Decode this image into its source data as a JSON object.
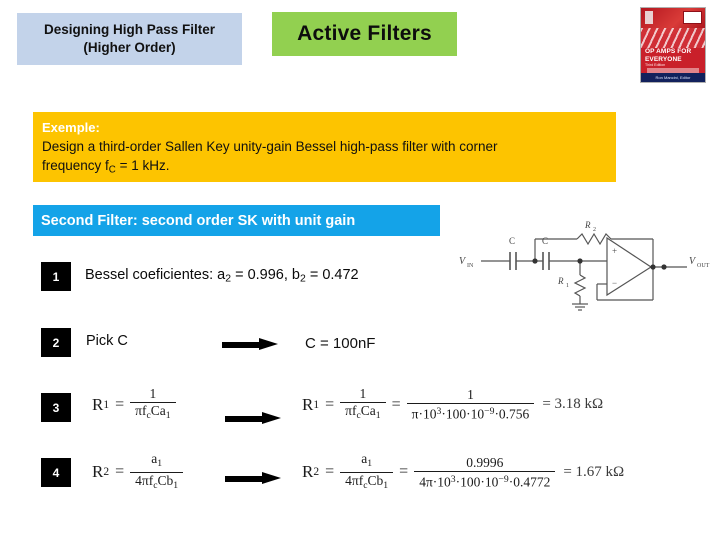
{
  "header": {
    "title_line1": "Designing High Pass Filter",
    "title_line2": "(Higher Order)",
    "topic": "Active Filters",
    "title_bg": "#c3d3ea",
    "topic_bg": "#92d050"
  },
  "book": {
    "title": "OP AMPS FOR EVERYONE",
    "edition": "Third Edition",
    "footer": "Ron Mancini, Editor",
    "cover_color": "#c9202a"
  },
  "example": {
    "label": "Exemple:",
    "line1_a": "Design a third-order Sallen Key unity-gain Bessel high-pass filter with corner",
    "line2_a": "frequency f",
    "line2_sub": "C",
    "line2_b": " = 1 kHz.",
    "bg": "#fdc400"
  },
  "section": {
    "label": "Second Filter: second order SK with unit gain",
    "bg": "#14a3e8"
  },
  "steps": [
    {
      "number": "1",
      "text_a": "Bessel coeficientes: a",
      "sub_a": "2",
      "text_b": " = 0.996, b",
      "sub_b": "2",
      "text_c": " = 0.472"
    },
    {
      "number": "2",
      "text": "Pick C",
      "arrow": "right-arrow",
      "result": "C = 100nF"
    },
    {
      "number": "3",
      "lhs_var": "R",
      "lhs_sub": "1",
      "formula_num": "1",
      "formula_den_a": "πf",
      "formula_den_sub": "c",
      "formula_den_b": "Ca",
      "formula_den_sub2": "1",
      "subst_num": "1",
      "subst_den_a": "π·10",
      "subst_den_exp": "3",
      "subst_den_b": "·100·10",
      "subst_den_exp2": "−9",
      "subst_den_c": "·0.756",
      "result": "= 3.18 kΩ"
    },
    {
      "number": "4",
      "lhs_var": "R",
      "lhs_sub": "2",
      "formula_num_a": "a",
      "formula_num_sub": "1",
      "formula_den_a": "4πf",
      "formula_den_sub": "c",
      "formula_den_b": "Cb",
      "formula_den_sub2": "1",
      "subst_num": "0.9996",
      "subst_den_a": "4π·10",
      "subst_den_exp": "3",
      "subst_den_b": "·100·10",
      "subst_den_exp2": "−9",
      "subst_den_c": "·0.4772",
      "result": "= 1.67 kΩ"
    }
  ],
  "circuit": {
    "input_label": "V",
    "input_sub": "IN",
    "output_label": "V",
    "output_sub": "OUT",
    "cap1": "C",
    "cap2": "C",
    "res1": "R",
    "res1_sub": "1",
    "res2": "R",
    "res2_sub": "2",
    "opamp_plus": "+",
    "opamp_minus": "−"
  }
}
